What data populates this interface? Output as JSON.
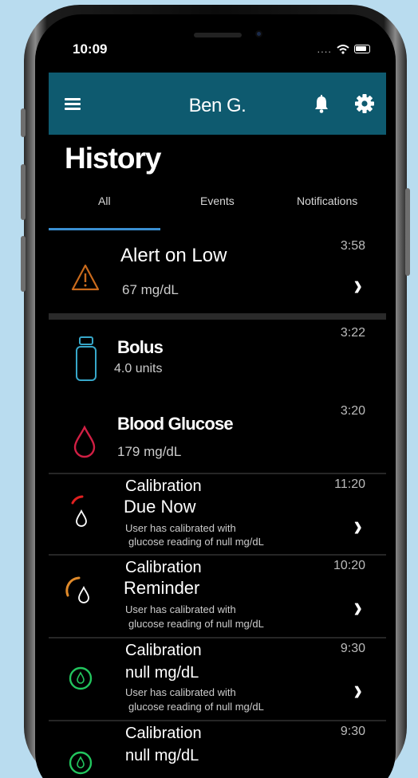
{
  "status": {
    "time": "10:09",
    "signal": "...."
  },
  "appbar": {
    "title": "Ben G."
  },
  "page": {
    "title": "History"
  },
  "tabs": [
    {
      "label": "All"
    },
    {
      "label": "Events"
    },
    {
      "label": "Notifications"
    }
  ],
  "colors": {
    "appbar": "#0e5a6f",
    "tab_indicator": "#3a8fd1",
    "alert_icon": "#c96a1c",
    "bolus_icon": "#37a7c9",
    "glucose_icon": "#d11f44",
    "cal_due_icon": "#e02020",
    "cal_reminder_icon": "#e08a2a",
    "cal_ok_icon": "#22c55e"
  },
  "items": [
    {
      "title": "Alert on Low",
      "subtitle": "67  mg/dL",
      "time": "3:58",
      "icon": "warning-triangle-icon"
    },
    {
      "title": "Bolus",
      "subtitle": "4.0 units",
      "time": "3:22",
      "icon": "insulin-vial-icon"
    },
    {
      "title": "Blood Glucose",
      "subtitle": "179  mg/dL",
      "time": "3:20",
      "icon": "blood-drop-icon"
    },
    {
      "title": "Calibration",
      "title2": "Due Now",
      "note1": "User has calibrated with",
      "note2": "glucose reading of null mg/dL",
      "time": "11:20",
      "icon": "calibration-due-icon"
    },
    {
      "title": "Calibration",
      "title2": "Reminder",
      "note1": "User has calibrated with",
      "note2": "glucose reading of null mg/dL",
      "time": "10:20",
      "icon": "calibration-reminder-icon"
    },
    {
      "title": "Calibration",
      "title2": "null mg/dL",
      "note1": "User has calibrated with",
      "note2": "glucose reading of null mg/dL",
      "time": "9:30",
      "icon": "calibration-ok-icon"
    },
    {
      "title": "Calibration",
      "title2": "null mg/dL",
      "time": "9:30",
      "icon": "calibration-ok-icon"
    }
  ]
}
